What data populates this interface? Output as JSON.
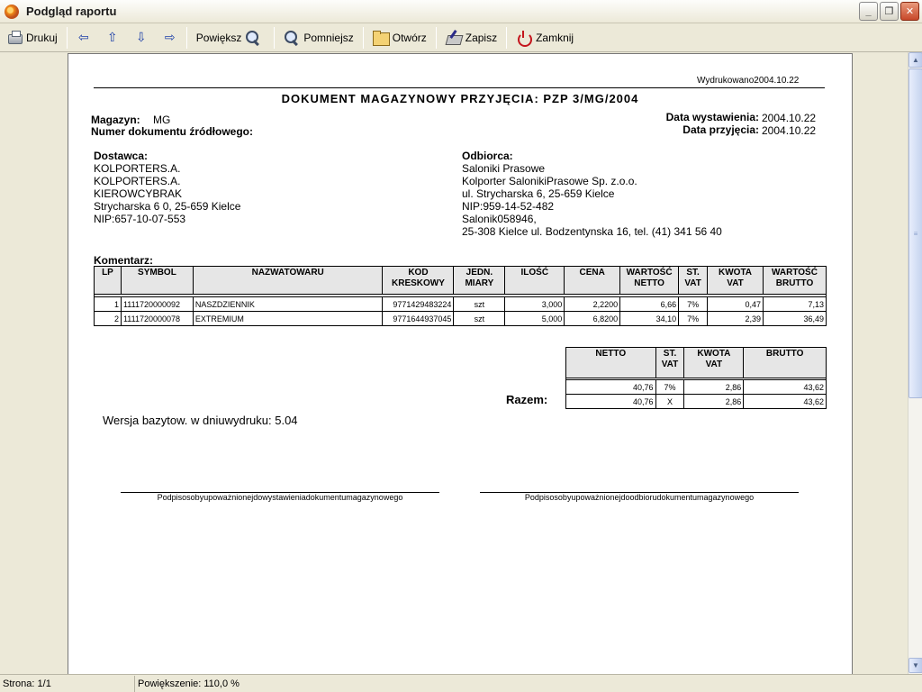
{
  "window": {
    "title": "Podgląd raportu",
    "controls": {
      "minimize": "_",
      "maximize": "❐",
      "close": "✕"
    }
  },
  "toolbar": {
    "print": "Drukuj",
    "first": "⇦",
    "prev": "⇧",
    "next": "⇩",
    "last": "⇨",
    "zoom_in": "Powiększ",
    "zoom_out": "Pomniejsz",
    "open": "Otwórz",
    "save": "Zapisz",
    "close": "Zamknij"
  },
  "report": {
    "printed": "Wydrukowano2004.10.22",
    "title": "DOKUMENT MAGAZYNOWY PRZYJĘCIA: PZP 3/MG/2004",
    "magazyn_label": "Magazyn:",
    "magazyn_value": "MG",
    "source_doc_label": "Numer dokumentu źródłowego:",
    "issue_date_label": "Data wystawienia:",
    "issue_date_value": "2004.10.22",
    "receipt_date_label": "Data przyjęcia:",
    "receipt_date_value": "2004.10.22",
    "supplier_label": "Dostawca:",
    "supplier_lines": [
      "KOLPORTERS.A.",
      "KOLPORTERS.A.",
      "KIEROWCYBRAK",
      "Strycharska 6 0, 25-659 Kielce",
      "NIP:657-10-07-553"
    ],
    "recipient_label": "Odbiorca:",
    "recipient_lines": [
      "Saloniki Prasowe",
      "Kolporter SalonikiPrasowe Sp. z.o.o.",
      "ul. Strycharska 6, 25-659 Kielce",
      "NIP:959-14-52-482",
      "Salonik058946,",
      "25-308 Kielce ul. Bodzentynska 16, tel. (41) 341 56 40"
    ],
    "comment_label": "Komentarz:",
    "items_headers": [
      "LP",
      "SYMBOL",
      "NAZWATOWARU",
      "KOD\nKRESKOWY",
      "JEDN.\nMIARY",
      "ILOŚĆ",
      "CENA",
      "WARTOŚĆ\nNETTO",
      "ST.\nVAT",
      "KWOTA\nVAT",
      "WARTOŚĆ\nBRUTTO"
    ],
    "items": [
      [
        "1",
        "1111720000092",
        "NASZDZIENNIK",
        "9771429483224",
        "szt",
        "3,000",
        "2,2200",
        "6,66",
        "7%",
        "0,47",
        "7,13"
      ],
      [
        "2",
        "1111720000078",
        "EXTREMIUM",
        "9771644937045",
        "szt",
        "5,000",
        "6,8200",
        "34,10",
        "7%",
        "2,39",
        "36,49"
      ]
    ],
    "summary_headers": [
      "NETTO",
      "ST.\nVAT",
      "KWOTA\nVAT",
      "BRUTTO"
    ],
    "summary_rows": [
      [
        "40,76",
        "7%",
        "2,86",
        "43,62"
      ],
      [
        "40,76",
        "X",
        "2,86",
        "43,62"
      ]
    ],
    "total_label": "Razem:",
    "version_text": "Wersja bazytow. w dniuwydruku: 5.04",
    "sign_left": "Podpisosobyupoważnionejdowystawieniadokumentumagazynowego",
    "sign_right": "Podpisosobyupoważnionejdoodbiorudokumentumagazynowego"
  },
  "status": {
    "page": "Strona: 1/1",
    "zoom": "Powiększenie: 110,0 %"
  }
}
